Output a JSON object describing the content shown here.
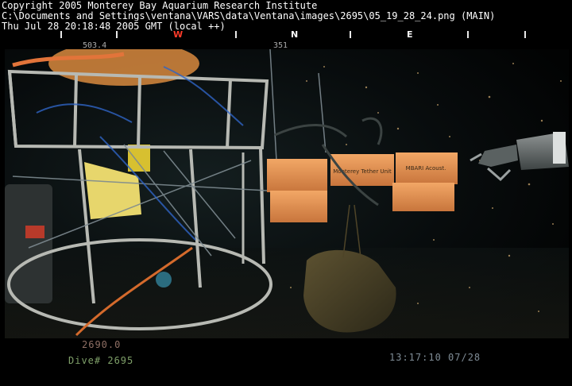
{
  "header": {
    "line1": "Copyright 2005 Monterey Bay Aquarium Research Institute",
    "line2": "C:\\Documents and Settings\\ventana\\VARS\\data\\Ventana\\images\\2695\\05_19_28_24.png (MAIN)",
    "line3": "Thu Jul 28 20:18:48 2005 GMT (local ++)"
  },
  "compass": {
    "labels": [
      {
        "text": "W",
        "color": "#ff3b2a"
      },
      {
        "text": "N",
        "color": "#ffffff"
      },
      {
        "text": "E",
        "color": "#ffffff"
      }
    ],
    "left_value": "503.4",
    "mid_value": "351"
  },
  "footer": {
    "depth": "2690.0",
    "dive": "Dive# 2695",
    "timecode": "13:17:10 07/28"
  },
  "box_labels": {
    "box_middle": "Monterey Tether Unit",
    "box_right": "MBARI Acoust."
  }
}
